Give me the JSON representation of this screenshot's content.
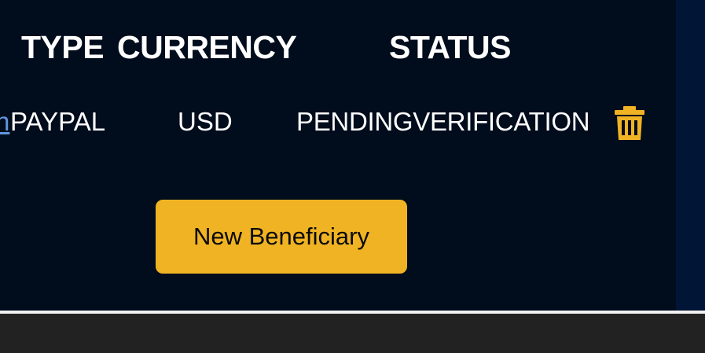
{
  "table": {
    "headers": {
      "type": "TYPE",
      "currency": "CURRENCY",
      "status": "STATUS"
    },
    "rows": [
      {
        "link_fragment": "n",
        "type": "PAYPAL",
        "currency": "USD",
        "status": "PENDINGVERIFICATION",
        "delete_icon": "trash-icon"
      }
    ]
  },
  "actions": {
    "new_beneficiary_label": "New Beneficiary"
  },
  "colors": {
    "panel_bg": "#010c1c",
    "side_strip": "#011636",
    "accent": "#f0b323",
    "link": "#5f97e0",
    "text": "#ffffff"
  }
}
